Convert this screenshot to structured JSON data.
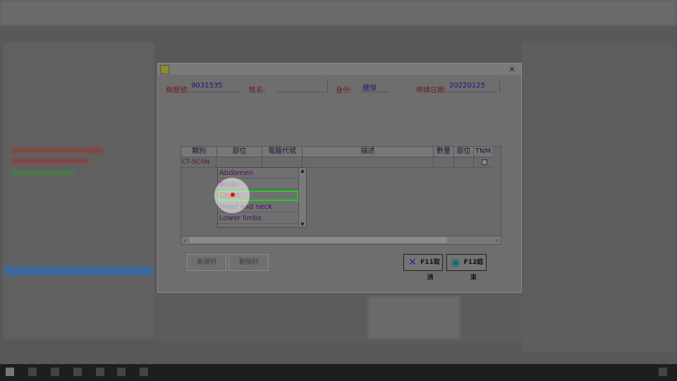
{
  "dialog": {
    "close_glyph": "×",
    "chart_no_label": "病歷號:",
    "chart_no_value": "9031535",
    "name_label": "姓名:",
    "identity_label": "身份:",
    "identity_value": "健保",
    "apply_date_label": "申請日期:",
    "apply_date_value": "20220125"
  },
  "grid": {
    "headers": [
      "類別",
      "部位",
      "電腦代號",
      "描述",
      "數量",
      "部位",
      "TNM"
    ],
    "row": {
      "category": "CT-SCAN"
    }
  },
  "dropdown": {
    "items": [
      "Abdomen",
      "Brain",
      "Chest",
      "Head and neck",
      "Lower limbs"
    ],
    "selected": "Chest"
  },
  "buttons": {
    "add_row": "新增列",
    "delete_row": "刪除列",
    "cancel": "F11取消",
    "finish": "F12結束"
  },
  "colors": {
    "selection_outline": "#22cc22",
    "cursor_dot": "#dd1111"
  }
}
